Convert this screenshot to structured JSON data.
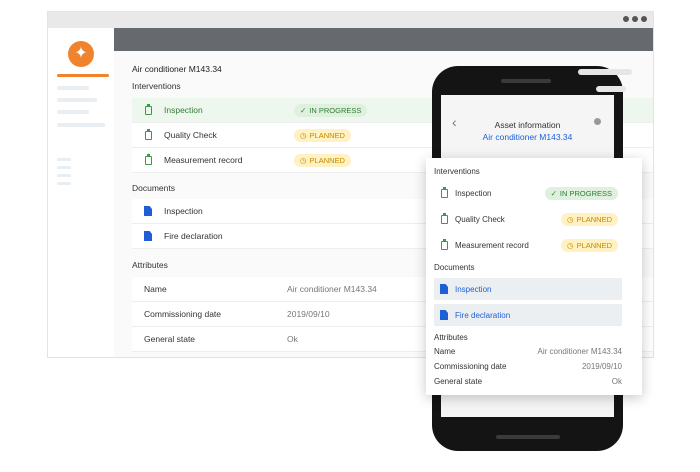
{
  "desktop": {
    "asset_title": "Air conditioner M143.34",
    "interventions_heading": "Interventions",
    "interventions": [
      {
        "label": "Inspection",
        "status": "IN PROGRESS"
      },
      {
        "label": "Quality Check",
        "status": "PLANNED"
      },
      {
        "label": "Measurement record",
        "status": "PLANNED"
      }
    ],
    "documents_heading": "Documents",
    "documents": [
      {
        "label": "Inspection"
      },
      {
        "label": "Fire declaration"
      }
    ],
    "attributes_heading": "Attributes",
    "attributes": [
      {
        "key": "Name",
        "value": "Air conditioner M143.34"
      },
      {
        "key": "Commissioning date",
        "value": "2019/09/10"
      },
      {
        "key": "General state",
        "value": "Ok"
      }
    ]
  },
  "mobile": {
    "header_title": "Asset information",
    "header_subtitle": "Air conditioner M143.34",
    "interventions_heading": "Interventions",
    "interventions": [
      {
        "label": "Inspection",
        "status": "IN PROGRESS"
      },
      {
        "label": "Quality Check",
        "status": "PLANNED"
      },
      {
        "label": "Measurement record",
        "status": "PLANNED"
      }
    ],
    "documents_heading": "Documents",
    "documents": [
      {
        "label": "Inspection"
      },
      {
        "label": "Fire declaration"
      }
    ],
    "attributes_heading": "Attributes",
    "attributes": [
      {
        "key": "Name",
        "value": "Air conditioner M143.34"
      },
      {
        "key": "Commissioning date",
        "value": "2019/09/10"
      },
      {
        "key": "General state",
        "value": "Ok"
      }
    ]
  },
  "colors": {
    "brand": "#f0832c",
    "topbar": "#666a6e",
    "in_progress": "#2e7d32",
    "planned": "#c58a00",
    "link": "#1e5fd8"
  },
  "icons": {
    "check": "✓",
    "clock": "◷",
    "star": "✦",
    "back": "‹"
  }
}
